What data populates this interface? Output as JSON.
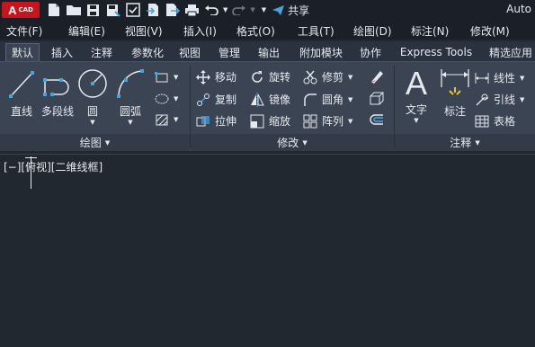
{
  "app": {
    "logo_letter": "A",
    "logo_text": "CAD",
    "title_partial": "Auto",
    "share_label": "共享"
  },
  "menus": [
    "文件(F)",
    "编辑(E)",
    "视图(V)",
    "插入(I)",
    "格式(O)",
    "工具(T)",
    "绘图(D)",
    "标注(N)",
    "修改(M)"
  ],
  "tabs": [
    "默认",
    "插入",
    "注释",
    "参数化",
    "视图",
    "管理",
    "输出",
    "附加模块",
    "协作",
    "Express Tools",
    "精选应用"
  ],
  "active_tab": "默认",
  "draw_panel": {
    "title": "绘图",
    "line": "直线",
    "polyline": "多段线",
    "circle": "圆",
    "arc": "圆弧"
  },
  "modify_panel": {
    "title": "修改",
    "move": "移动",
    "rotate": "旋转",
    "trim": "修剪",
    "copy": "复制",
    "mirror": "镜像",
    "fillet": "圆角",
    "stretch": "拉伸",
    "scale": "缩放",
    "array": "阵列"
  },
  "annotation_panel": {
    "title": "注释",
    "text": "文字",
    "text_glyph": "A",
    "dimension": "标注",
    "linear": "线性",
    "leader": "引线",
    "table": "表格"
  },
  "viewport": {
    "label": "[−][俯视][二维线框]"
  },
  "colors": {
    "accent_blue": "#4aa3df",
    "logo_red": "#c4161c",
    "ribbon_bg": "#3b4453",
    "canvas_bg": "#212830"
  }
}
